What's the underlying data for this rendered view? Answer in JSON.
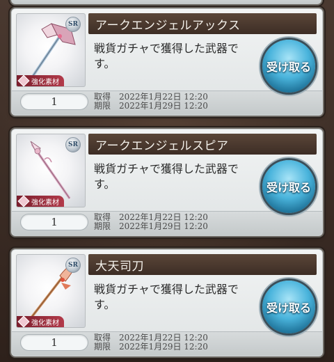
{
  "items": [
    {
      "title": "アークエンジェルアックス",
      "rarity": "SR",
      "material_tag": "強化素材",
      "description": "戦貨ガチャで獲得した武器です。",
      "quantity": "1",
      "acquired_label": "取得",
      "acquired_date": "2022年1月22日 12:20",
      "expiry_label": "期限",
      "expiry_date": "2022年1月29日 12:20",
      "button_label": "受け取る",
      "weapon_icon": "axe-icon"
    },
    {
      "title": "アークエンジェルスピア",
      "rarity": "SR",
      "material_tag": "強化素材",
      "description": "戦貨ガチャで獲得した武器です。",
      "quantity": "1",
      "acquired_label": "取得",
      "acquired_date": "2022年1月22日 12:20",
      "expiry_label": "期限",
      "expiry_date": "2022年1月29日 12:20",
      "button_label": "受け取る",
      "weapon_icon": "spear-icon"
    },
    {
      "title": "大天司刀",
      "rarity": "SR",
      "material_tag": "強化素材",
      "description": "戦貨ガチャで獲得した武器です。",
      "quantity": "1",
      "acquired_label": "取得",
      "acquired_date": "2022年1月22日 12:20",
      "expiry_label": "期限",
      "expiry_date": "2022年1月29日 12:20",
      "button_label": "受け取る",
      "weapon_icon": "glaive-icon"
    }
  ],
  "colors": {
    "title_bar": "#4a392d",
    "button_blue": "#3aa6d3",
    "material_tag": "#9a2b3c"
  }
}
